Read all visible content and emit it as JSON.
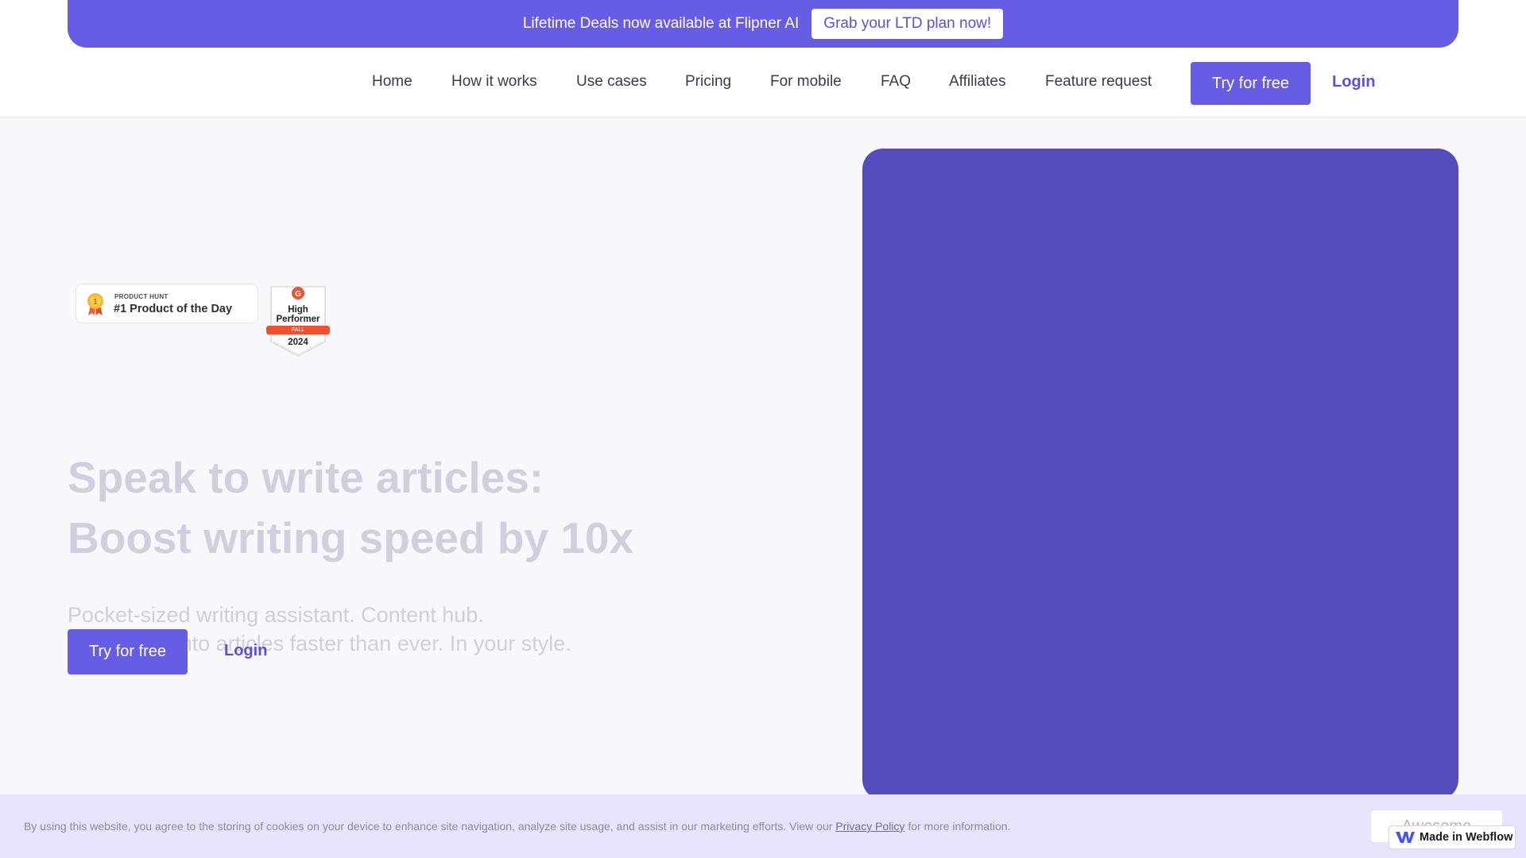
{
  "promo": {
    "text": "Lifetime Deals now available at Flipner AI",
    "button": "Grab your LTD plan now!"
  },
  "nav": {
    "items": [
      "Home",
      "How it works",
      "Use cases",
      "Pricing",
      "For mobile",
      "FAQ",
      "Affiliates",
      "Feature request"
    ],
    "try_label": "Try for free",
    "login_label": "Login"
  },
  "badges": {
    "product_hunt": {
      "small": "PRODUCT HUNT",
      "big": "#1 Product of the Day"
    },
    "g2": {
      "line1": "High",
      "line2": "Performer",
      "ribbon": "FALL",
      "year": "2024"
    }
  },
  "hero": {
    "title_line1": "Speak to write articles:",
    "title_line2": "Boost writing speed by 10x",
    "sub_line1": "Pocket-sized writing assistant. Content hub.",
    "sub_line2": "Turn audio into articles faster than ever. In your style.",
    "try_label": "Try for free",
    "login_label": "Login"
  },
  "cookie": {
    "text_before": "By using this website, you agree to the storing of cookies on your device to enhance site navigation, analyze site usage, and assist in our marketing efforts. View our ",
    "link": "Privacy Policy",
    "text_after": " for more information.",
    "button": "Awesome"
  },
  "webflow_badge": "Made in Webflow",
  "colors": {
    "accent": "#675ce4",
    "panel": "#544bbd",
    "cookie_bg": "#e6e4fa"
  },
  "icons": [
    "medal-icon",
    "g2-badge-icon",
    "webflow-logo-icon"
  ]
}
